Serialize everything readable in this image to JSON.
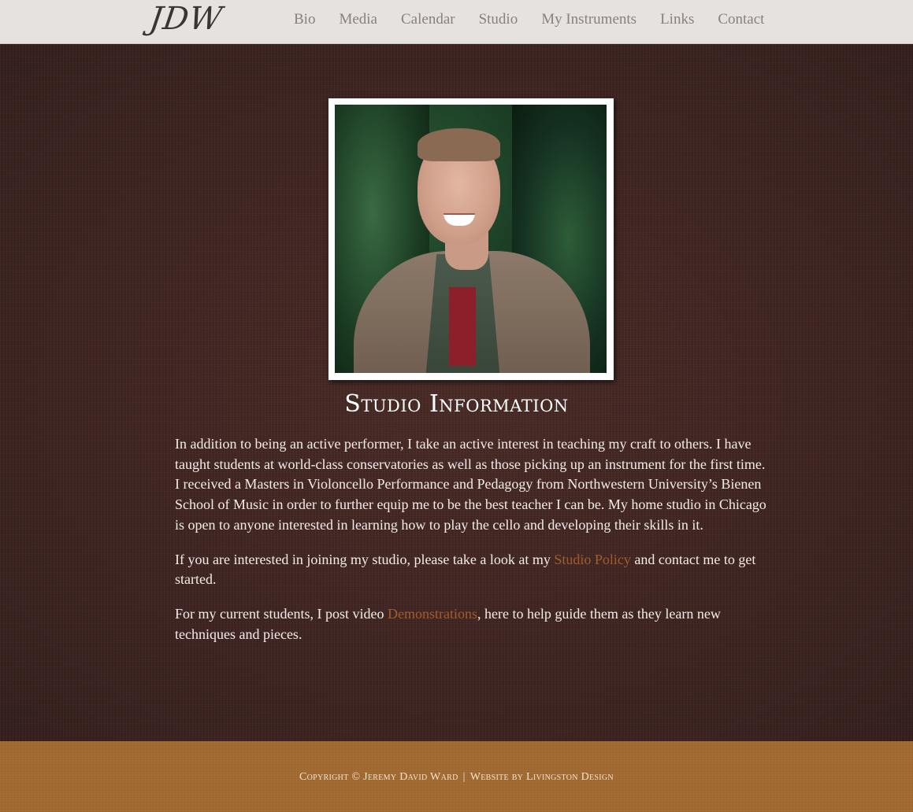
{
  "header": {
    "logo_text": "JDW",
    "nav": [
      {
        "label": "Bio"
      },
      {
        "label": "Media"
      },
      {
        "label": "Calendar"
      },
      {
        "label": "Studio"
      },
      {
        "label": "My Instruments"
      },
      {
        "label": "Links"
      },
      {
        "label": "Contact"
      }
    ]
  },
  "main": {
    "title": "Studio Information",
    "paragraphs": {
      "p1": "In addition to being an active performer, I take an active interest in teaching my craft to others. I have taught students at world-class conservatories as well as those picking up an instrument for the first time. I received a Masters in Violoncello Performance and Pedagogy from Northwestern University’s Bienen School of Music in order to further equip me to be the best teacher I can be. My home studio in Chicago is open to anyone interested in learning how to play the cello and developing their skills in it.",
      "p2_before": "If you are interested in joining my studio, please take a look at my ",
      "p2_link": "Studio Policy",
      "p2_after": " and contact me to get started.",
      "p3_before": "For my current students, I post video ",
      "p3_link": "Demonstrations",
      "p3_after": ", here to help guide them as they learn new techniques and pieces."
    }
  },
  "footer": {
    "copyright": "Copyright © Jeremy David Ward",
    "separator": "|",
    "credit": "Website by Livingston Design"
  },
  "colors": {
    "nav_bg": "#e6e2e0",
    "nav_text": "#8a7f7b",
    "main_bg": "#42261f",
    "link": "#a35d2c",
    "footer_bg": "#a36a32"
  }
}
